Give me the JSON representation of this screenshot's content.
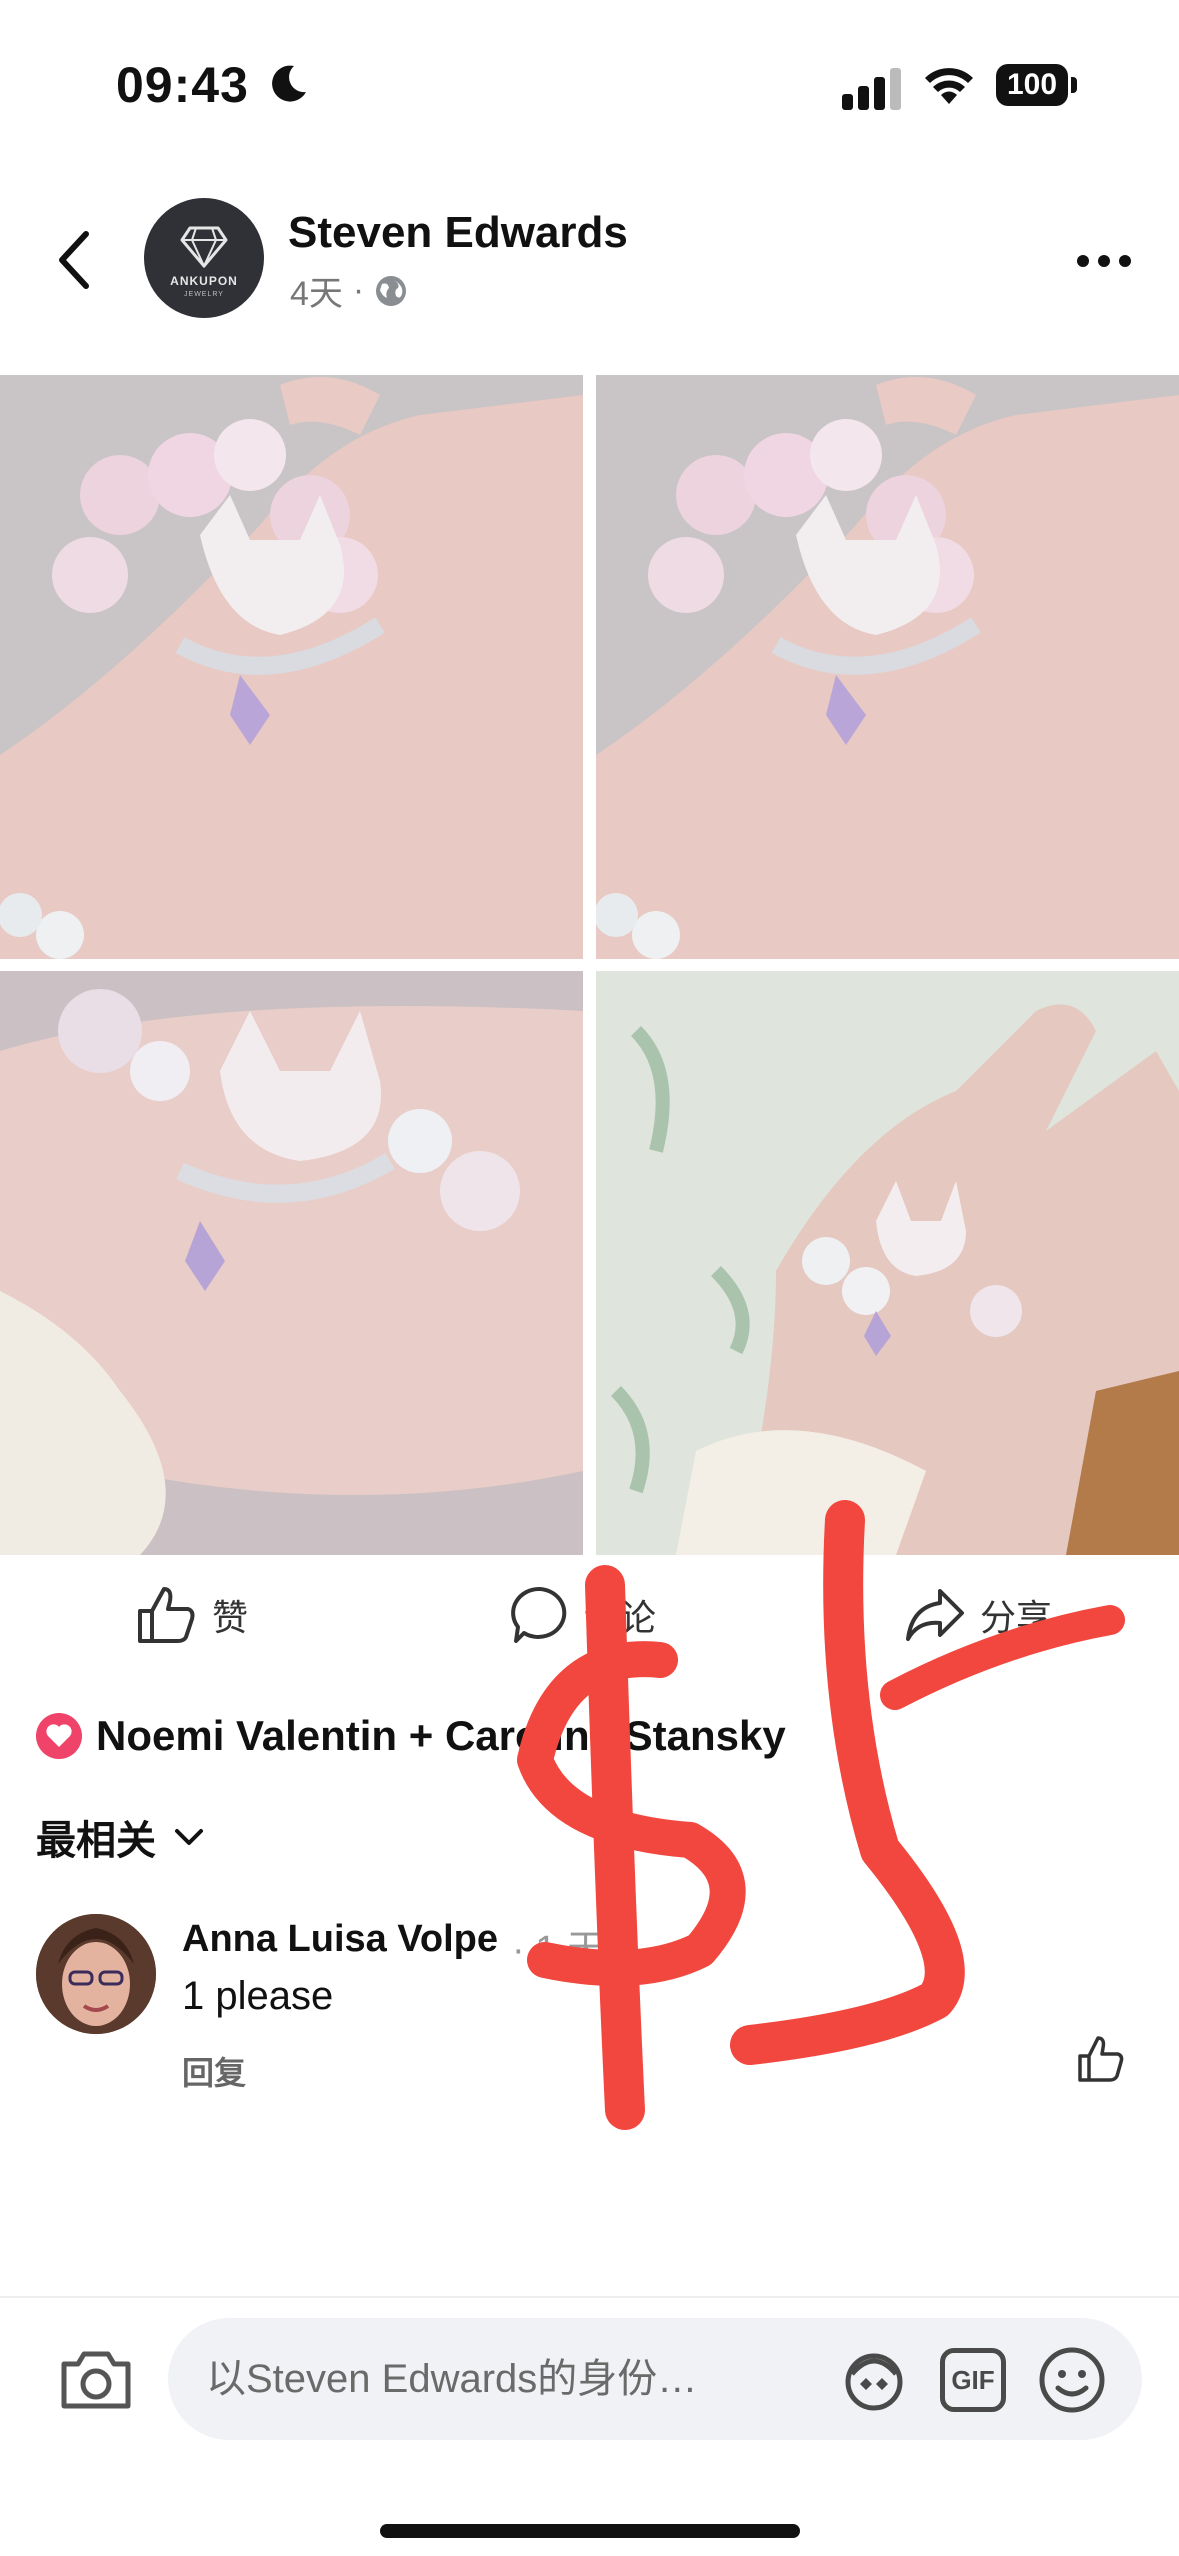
{
  "status_bar": {
    "time": "09:43",
    "battery": "100"
  },
  "header": {
    "brand_name": "ANKUPON",
    "brand_sub": "JEWELRY",
    "author": "Steven Edwards",
    "age": "4天",
    "separator": "·"
  },
  "actions": {
    "like": "赞",
    "comment": "评论",
    "share": "分享"
  },
  "reactions": {
    "names": "Noemi Valentin + Caroline Stansky"
  },
  "sort": {
    "label": "最相关"
  },
  "comment": {
    "name": "Anna Luisa Volpe",
    "dots": "· 1 天 ·",
    "text": "1 please",
    "reply": "回复"
  },
  "compose": {
    "placeholder": "以Steven Edwards的身份…",
    "gif": "GIF"
  },
  "colors": {
    "accent_red": "#f0436a",
    "ink": "#111111",
    "scribble": "#f2473e"
  }
}
